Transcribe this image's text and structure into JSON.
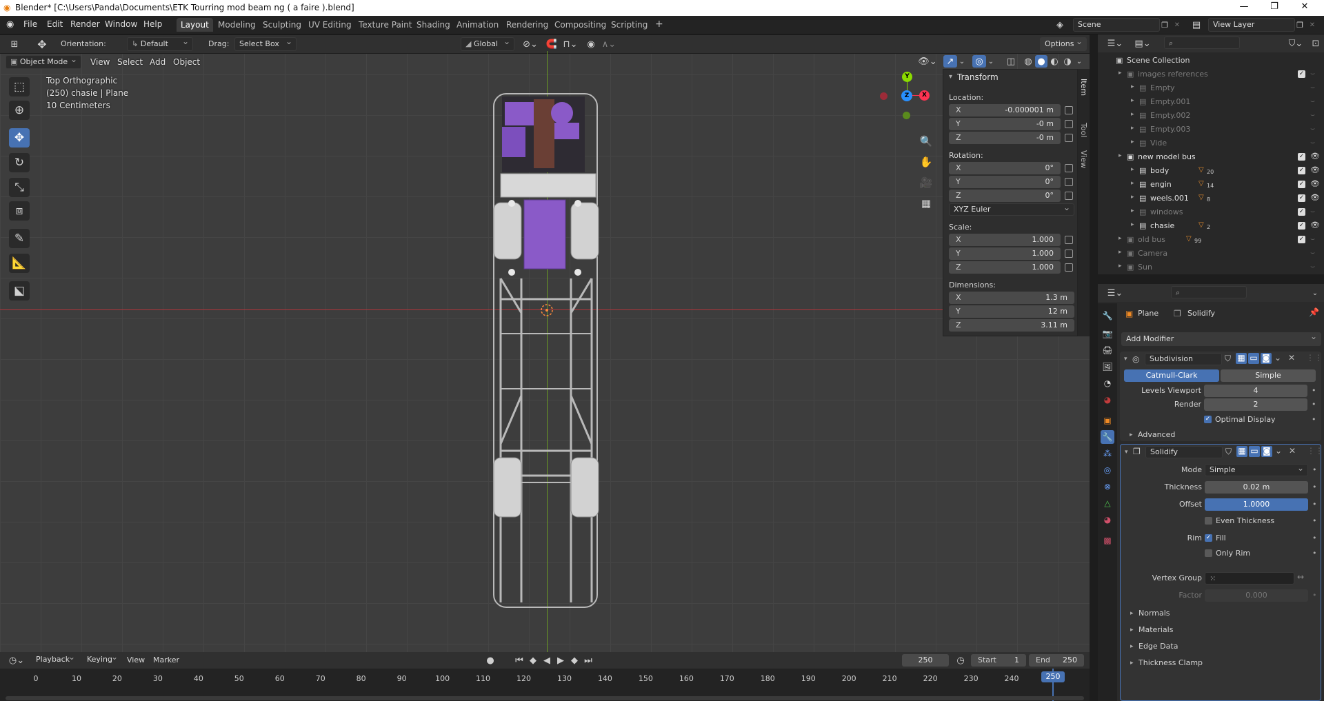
{
  "window": {
    "title": "Blender* [C:\\Users\\Panda\\Documents\\ETK Tourring mod beam ng ( a faire ).blend]",
    "min": "—",
    "max": "❐",
    "close": "✕"
  },
  "menus": [
    "File",
    "Edit",
    "Render",
    "Window",
    "Help"
  ],
  "workspaces": {
    "active": "Layout",
    "tabs": [
      "Layout",
      "Modeling",
      "Sculpting",
      "UV Editing",
      "Texture Paint",
      "Shading",
      "Animation",
      "Rendering",
      "Compositing",
      "Scripting"
    ],
    "add": "+"
  },
  "scene": {
    "name": "Scene",
    "view_layer": "View Layer"
  },
  "toolheader": {
    "orientation_label": "Orientation:",
    "orientation_value": "Default",
    "drag_label": "Drag:",
    "drag_value": "Select Box",
    "transform": "Global",
    "options": "Options"
  },
  "viewheader": {
    "mode": "Object Mode",
    "items": [
      "View",
      "Select",
      "Add",
      "Object"
    ]
  },
  "overlay": {
    "line1": "Top Orthographic",
    "line2": "(250) chasie | Plane",
    "line3": "10 Centimeters"
  },
  "gizmo": {
    "x": "X",
    "y": "Y",
    "z": "Z"
  },
  "npanel": {
    "header": "Transform",
    "location_label": "Location:",
    "location": [
      {
        "axis": "X",
        "value": "-0.000001 m"
      },
      {
        "axis": "Y",
        "value": "-0 m"
      },
      {
        "axis": "Z",
        "value": "-0 m"
      }
    ],
    "rotation_label": "Rotation:",
    "rotation": [
      {
        "axis": "X",
        "value": "0°"
      },
      {
        "axis": "Y",
        "value": "0°"
      },
      {
        "axis": "Z",
        "value": "0°"
      }
    ],
    "rotation_mode": "XYZ Euler",
    "scale_label": "Scale:",
    "scale": [
      {
        "axis": "X",
        "value": "1.000"
      },
      {
        "axis": "Y",
        "value": "1.000"
      },
      {
        "axis": "Z",
        "value": "1.000"
      }
    ],
    "dimensions_label": "Dimensions:",
    "dimensions": [
      {
        "axis": "X",
        "value": "1.3 m"
      },
      {
        "axis": "Y",
        "value": "12 m"
      },
      {
        "axis": "Z",
        "value": "3.11 m"
      }
    ],
    "tabs": [
      "Item",
      "Tool",
      "View"
    ]
  },
  "outliner": {
    "root": "Scene Collection",
    "rows": [
      {
        "name": "images references",
        "indent": 1,
        "dim": true,
        "check": true
      },
      {
        "name": "Empty",
        "indent": 2,
        "dim": true
      },
      {
        "name": "Empty.001",
        "indent": 2,
        "dim": true
      },
      {
        "name": "Empty.002",
        "indent": 2,
        "dim": true
      },
      {
        "name": "Empty.003",
        "indent": 2,
        "dim": true
      },
      {
        "name": "Vide",
        "indent": 2,
        "dim": true
      },
      {
        "name": "new model bus",
        "indent": 1,
        "dim": false,
        "check": true,
        "eye": true
      },
      {
        "name": "body",
        "indent": 2,
        "dim": false,
        "check": true,
        "eye": true,
        "badge": "20"
      },
      {
        "name": "engin",
        "indent": 2,
        "dim": false,
        "check": true,
        "eye": true,
        "badge": "14"
      },
      {
        "name": "weels.001",
        "indent": 2,
        "dim": false,
        "check": true,
        "eye": true,
        "badge": "8"
      },
      {
        "name": "windows",
        "indent": 2,
        "dim": true,
        "check": true
      },
      {
        "name": "chasie",
        "indent": 2,
        "dim": false,
        "check": true,
        "eye": true,
        "badge": "2"
      },
      {
        "name": "old bus",
        "indent": 1,
        "dim": true,
        "check": true,
        "badge": "99"
      },
      {
        "name": "Camera",
        "indent": 1,
        "dim": true
      },
      {
        "name": "Sun",
        "indent": 1,
        "dim": true
      }
    ]
  },
  "properties": {
    "object": "Plane",
    "modifier_crumb": "Solidify",
    "add_modifier": "Add Modifier",
    "subdivision": {
      "name": "Subdivision",
      "catmull": "Catmull-Clark",
      "simple": "Simple",
      "levels_label": "Levels Viewport",
      "levels": "4",
      "render_label": "Render",
      "render": "2",
      "optimal": "Optimal Display",
      "advanced": "Advanced"
    },
    "solidify": {
      "name": "Solidify",
      "mode_label": "Mode",
      "mode": "Simple",
      "thickness_label": "Thickness",
      "thickness": "0.02 m",
      "offset_label": "Offset",
      "offset": "1.0000",
      "offset_fraction": 1.0,
      "even": "Even Thickness",
      "rim_label": "Rim",
      "fill": "Fill",
      "only_rim": "Only Rim",
      "vgroup_label": "Vertex Group",
      "factor_label": "Factor",
      "factor": "0.000",
      "sections": [
        "Normals",
        "Materials",
        "Edge Data",
        "Thickness Clamp"
      ]
    }
  },
  "timeline": {
    "playback": "Playback",
    "keying": "Keying",
    "view": "View",
    "marker": "Marker",
    "current_frame": "250",
    "start_label": "Start",
    "start": "1",
    "end_label": "End",
    "end": "250",
    "ticks": [
      "0",
      "10",
      "20",
      "30",
      "40",
      "50",
      "60",
      "70",
      "80",
      "90",
      "100",
      "110",
      "120",
      "130",
      "140",
      "150",
      "160",
      "170",
      "180",
      "190",
      "200",
      "210",
      "220",
      "230",
      "240",
      "250"
    ]
  },
  "colors": {
    "accent": "#4772b3",
    "x_axis": "#ff3352",
    "y_axis": "#8bdc00",
    "z_axis": "#2890ff",
    "mesh_purple": "#8a5ac8",
    "mesh_gray": "#b9b9b9"
  }
}
